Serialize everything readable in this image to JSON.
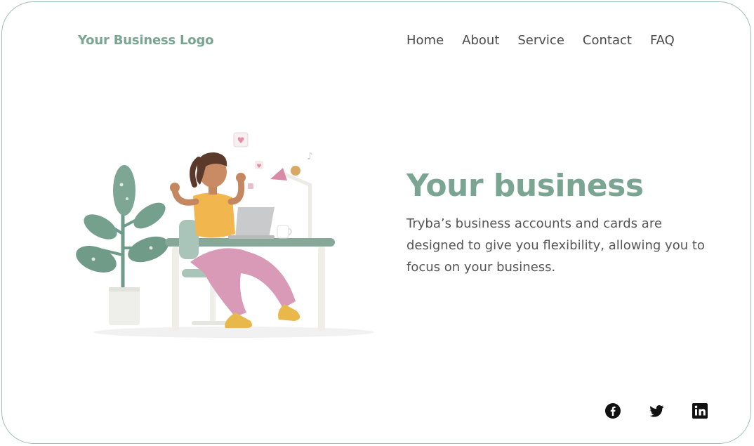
{
  "header": {
    "logo_text": "Your Business Logo",
    "nav": [
      {
        "label": "Home"
      },
      {
        "label": "About"
      },
      {
        "label": "Service"
      },
      {
        "label": "Contact"
      },
      {
        "label": "FAQ"
      }
    ]
  },
  "hero": {
    "title": "Your business",
    "description": "Tryba’s business accounts and cards are designed to give you flexibility, allowing you to focus on your business."
  },
  "social": [
    "facebook-icon",
    "twitter-icon",
    "linkedin-icon"
  ],
  "colors": {
    "accent": "#7aa593",
    "border": "#9dbdb0",
    "text": "#555555",
    "nav_text": "#4a4a4a"
  }
}
